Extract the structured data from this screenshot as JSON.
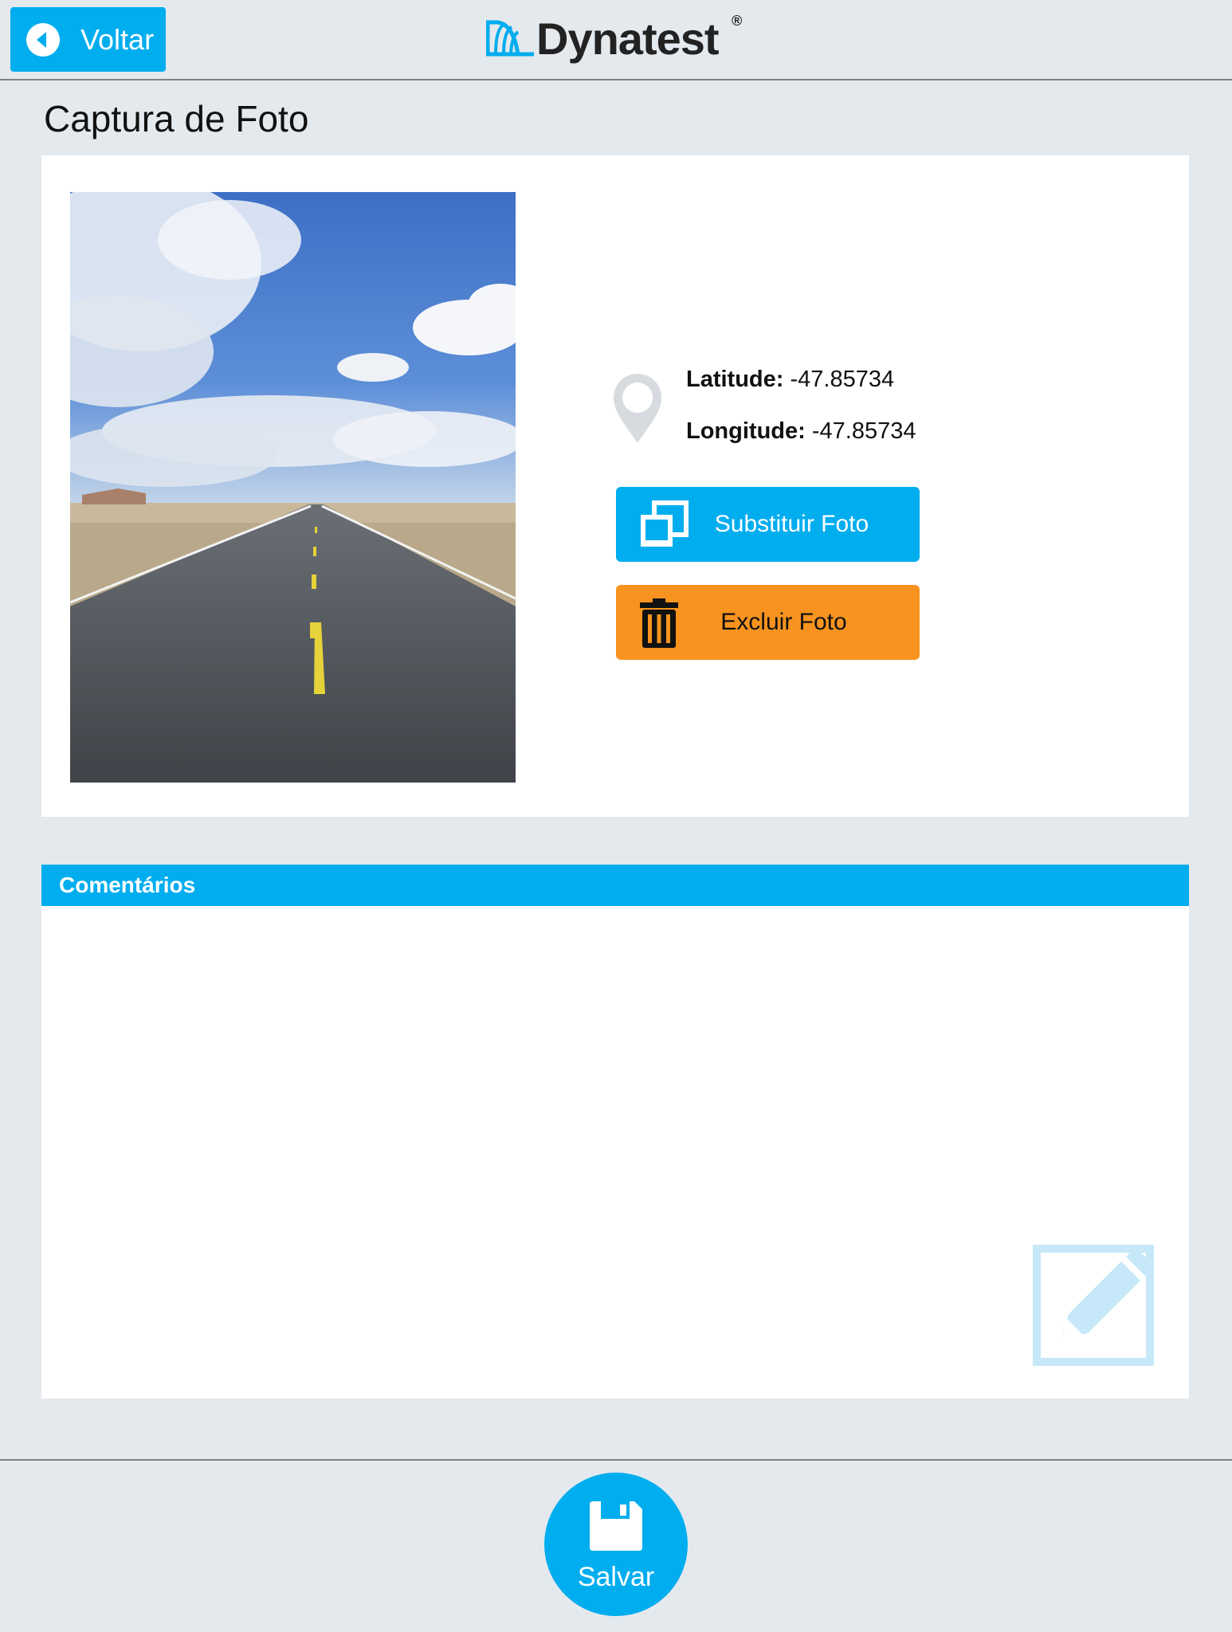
{
  "header": {
    "back_label": "Voltar",
    "logo_text": "Dynatest",
    "logo_reg": "®"
  },
  "page": {
    "title": "Captura de Foto"
  },
  "photo": {
    "description_icon": "road-photo",
    "geo": {
      "latitude_label": "Latitude:",
      "latitude_value": "-47.85734",
      "longitude_label": "Longitude:",
      "longitude_value": "-47.85734"
    },
    "replace_label": "Substituir Foto",
    "delete_label": "Excluir Foto"
  },
  "comments": {
    "header": "Comentários",
    "value": "",
    "placeholder": ""
  },
  "footer": {
    "save_label": "Salvar"
  },
  "colors": {
    "accent": "#00adef",
    "delete": "#f7931e",
    "background": "#e4e9ee"
  }
}
